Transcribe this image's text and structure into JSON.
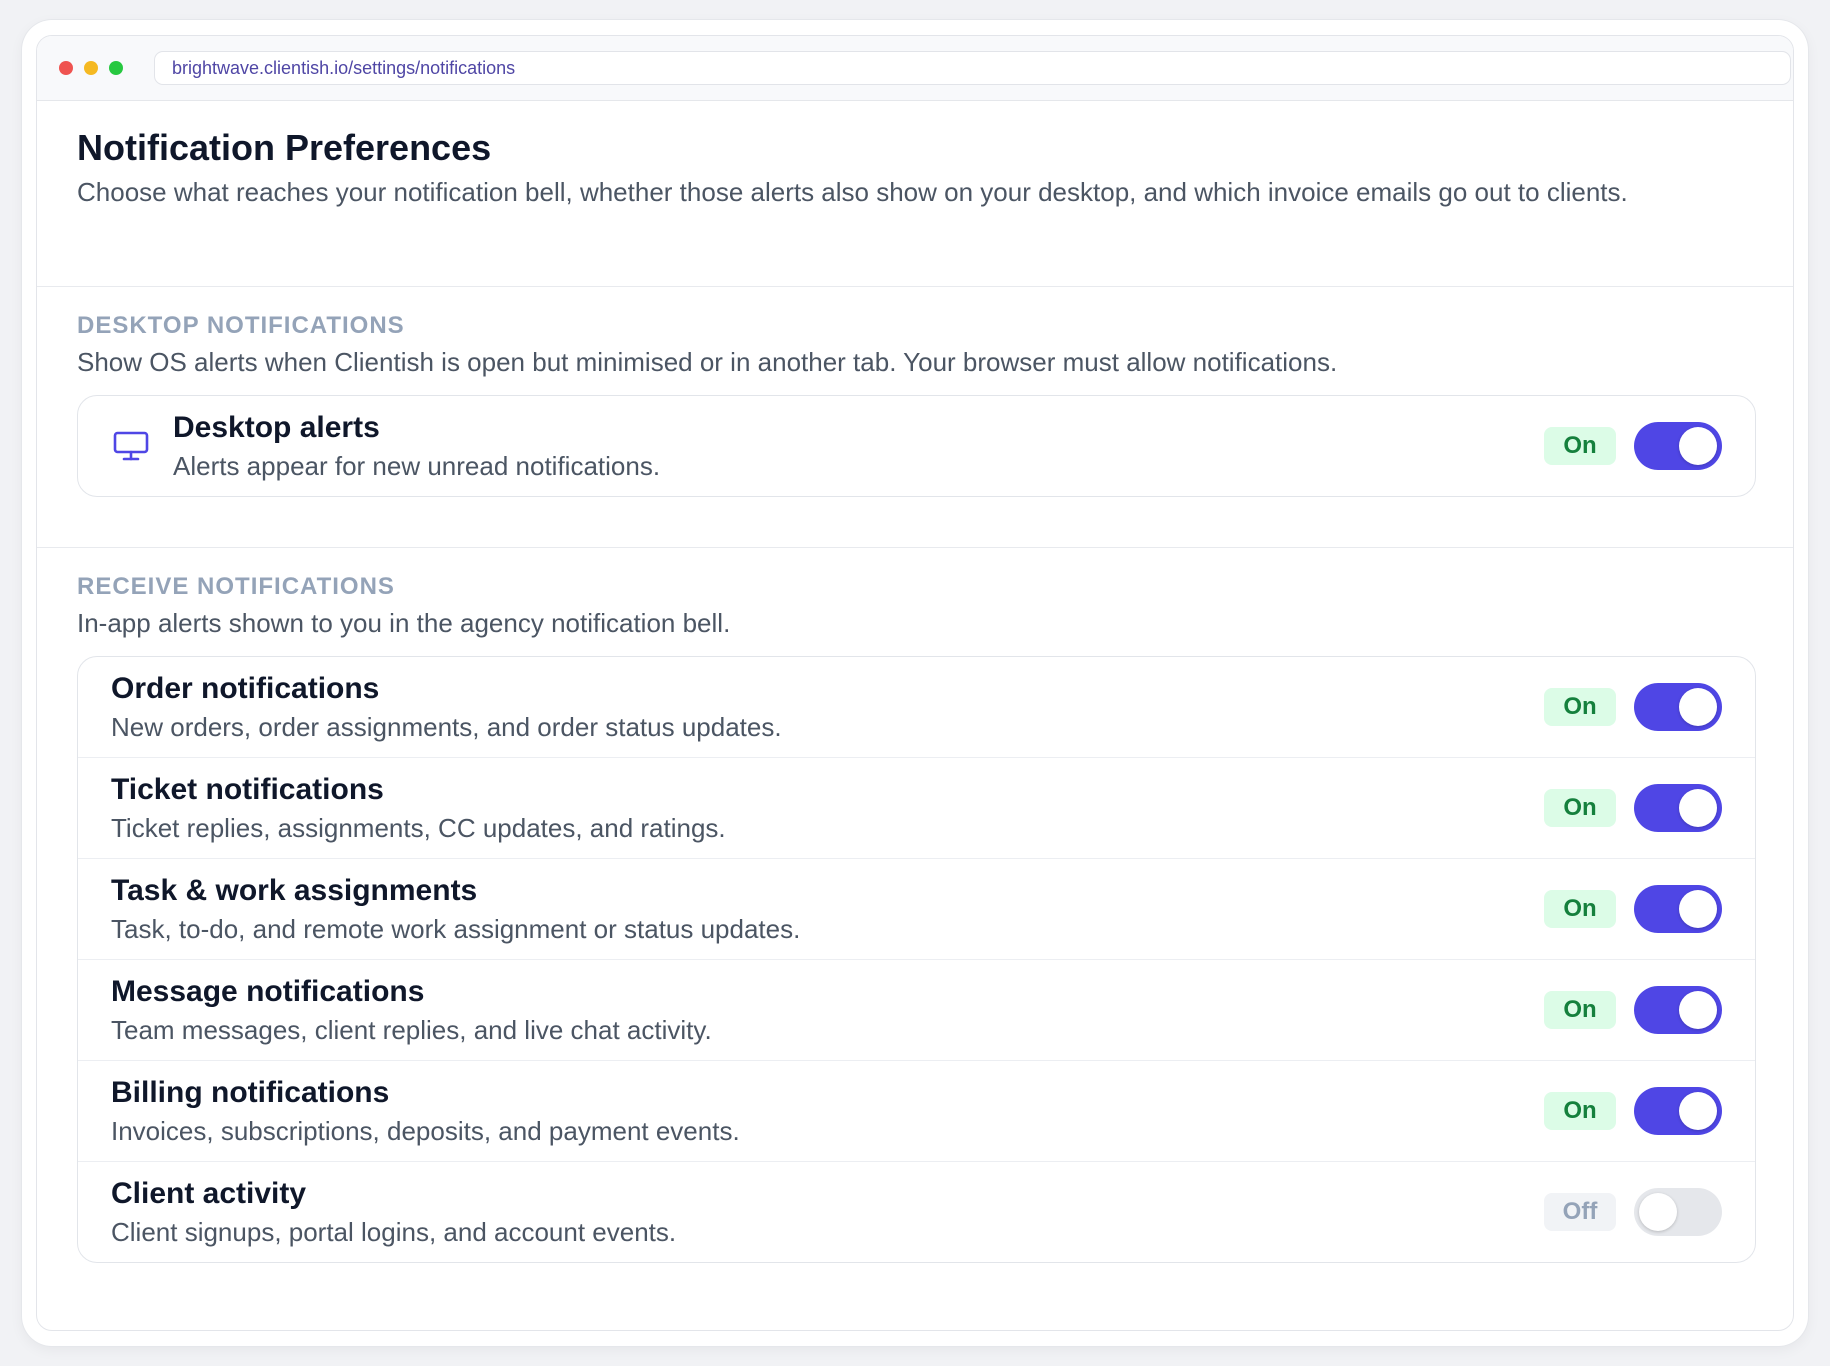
{
  "browser": {
    "url": "brightwave.clientish.io/settings/notifications"
  },
  "page": {
    "title": "Notification Preferences",
    "subtitle": "Choose what reaches your notification bell, whether those alerts also show on your desktop, and which invoice emails go out to clients."
  },
  "desktop_section": {
    "heading": "DESKTOP NOTIFICATIONS",
    "description": "Show OS alerts when Clientish is open but minimised or in another tab. Your browser must allow notifications.",
    "item": {
      "icon": "monitor-icon",
      "title": "Desktop alerts",
      "description": "Alerts appear for new unread notifications.",
      "status": "On",
      "enabled": true
    }
  },
  "receive_section": {
    "heading": "RECEIVE NOTIFICATIONS",
    "description": "In-app alerts shown to you in the agency notification bell.",
    "items": [
      {
        "title": "Order notifications",
        "description": "New orders, order assignments, and order status updates.",
        "status": "On",
        "enabled": true
      },
      {
        "title": "Ticket notifications",
        "description": "Ticket replies, assignments, CC updates, and ratings.",
        "status": "On",
        "enabled": true
      },
      {
        "title": "Task & work assignments",
        "description": "Task, to-do, and remote work assignment or status updates.",
        "status": "On",
        "enabled": true
      },
      {
        "title": "Message notifications",
        "description": "Team messages, client replies, and live chat activity.",
        "status": "On",
        "enabled": true
      },
      {
        "title": "Billing notifications",
        "description": "Invoices, subscriptions, deposits, and payment events.",
        "status": "On",
        "enabled": true
      },
      {
        "title": "Client activity",
        "description": "Client signups, portal logins, and account events.",
        "status": "Off",
        "enabled": false
      }
    ]
  },
  "colors": {
    "accent": "#4f46e5",
    "on_badge_bg": "#dcfce7",
    "on_badge_text": "#15803d",
    "off_badge_text": "#94a3b8",
    "off_toggle": "#e5e7eb"
  }
}
